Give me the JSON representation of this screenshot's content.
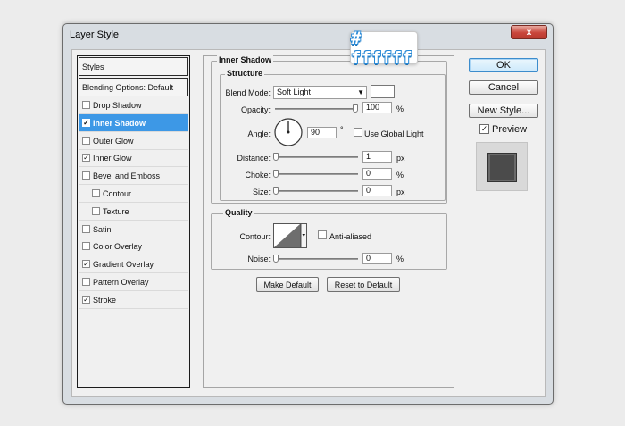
{
  "window": {
    "title": "Layer Style",
    "close_glyph": "x"
  },
  "annotation": {
    "text": "# ffffff"
  },
  "left_list": {
    "header": "Styles",
    "blending": "Blending Options: Default",
    "items": [
      {
        "label": "Drop Shadow",
        "checked": false,
        "selected": false,
        "sub": false
      },
      {
        "label": "Inner Shadow",
        "checked": true,
        "selected": true,
        "sub": false
      },
      {
        "label": "Outer Glow",
        "checked": false,
        "selected": false,
        "sub": false
      },
      {
        "label": "Inner Glow",
        "checked": true,
        "selected": false,
        "sub": false
      },
      {
        "label": "Bevel and Emboss",
        "checked": false,
        "selected": false,
        "sub": false
      },
      {
        "label": "Contour",
        "checked": false,
        "selected": false,
        "sub": true
      },
      {
        "label": "Texture",
        "checked": false,
        "selected": false,
        "sub": true
      },
      {
        "label": "Satin",
        "checked": false,
        "selected": false,
        "sub": false
      },
      {
        "label": "Color Overlay",
        "checked": false,
        "selected": false,
        "sub": false
      },
      {
        "label": "Gradient Overlay",
        "checked": true,
        "selected": false,
        "sub": false
      },
      {
        "label": "Pattern Overlay",
        "checked": false,
        "selected": false,
        "sub": false
      },
      {
        "label": "Stroke",
        "checked": true,
        "selected": false,
        "sub": false
      }
    ]
  },
  "panel": {
    "title": "Inner Shadow",
    "structure": {
      "legend": "Structure",
      "blend_mode_label": "Blend Mode:",
      "blend_mode_value": "Soft Light",
      "blend_color": "#ffffff",
      "opacity_label": "Opacity:",
      "opacity_value": "100",
      "opacity_fraction": 1.0,
      "percent": "%",
      "angle_label": "Angle:",
      "angle_value": "90",
      "degree": "°",
      "global_light_label": "Use Global Light",
      "global_light_checked": false,
      "distance_label": "Distance:",
      "distance_value": "1",
      "choke_label": "Choke:",
      "choke_value": "0",
      "size_label": "Size:",
      "size_value": "0",
      "px": "px"
    },
    "quality": {
      "legend": "Quality",
      "contour_label": "Contour:",
      "anti_aliased_label": "Anti-aliased",
      "anti_aliased_checked": false,
      "noise_label": "Noise:",
      "noise_value": "0",
      "percent": "%"
    },
    "make_default": "Make Default",
    "reset_default": "Reset to Default"
  },
  "right": {
    "ok": "OK",
    "cancel": "Cancel",
    "new_style": "New Style...",
    "preview_label": "Preview",
    "preview_checked": true
  },
  "colors": {
    "selection": "#3d98e6",
    "accent": "#2a8ad6"
  }
}
